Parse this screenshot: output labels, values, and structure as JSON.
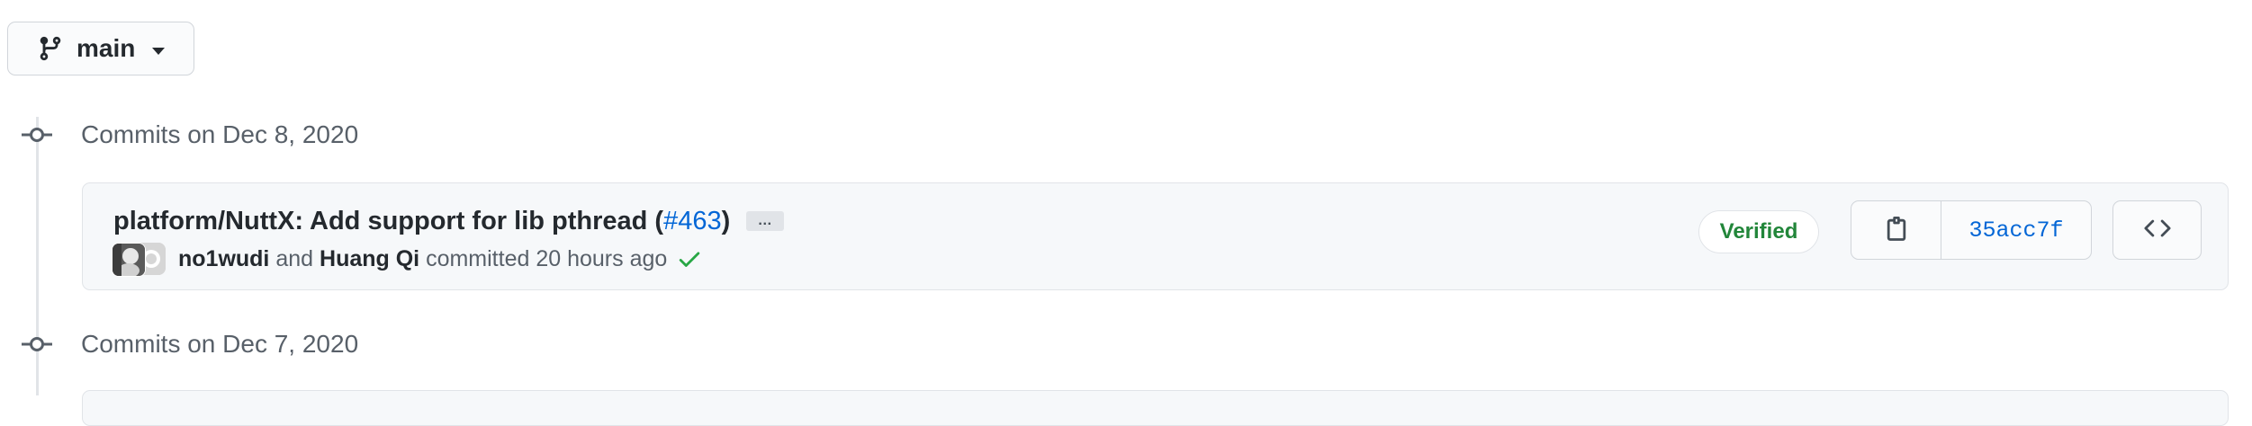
{
  "branch": {
    "name": "main",
    "icon": "git-branch-icon",
    "caret_icon": "triangle-down-icon"
  },
  "groups": [
    {
      "title": "Commits on Dec 8, 2020",
      "commits": [
        {
          "title_text": "platform/NuttX: Add support for lib pthread (",
          "pr_ref": "#463",
          "title_close": ")",
          "ellipsis": "…",
          "author_primary": "no1wudi",
          "connector": "and",
          "author_secondary": "Huang Qi",
          "committed_text": "committed 20 hours ago",
          "status_icon": "check-icon",
          "status_color": "#28a745",
          "verified_label": "Verified",
          "verified_color": "#22863a",
          "copy_icon": "clipboard-icon",
          "sha": "35acc7f",
          "browse_icon": "code-icon"
        }
      ]
    },
    {
      "title": "Commits on Dec 7, 2020"
    }
  ],
  "colors": {
    "link": "#0366d6",
    "muted": "#586069",
    "text": "#24292e",
    "border": "#e1e4e8",
    "box_bg": "#f6f8fa"
  }
}
